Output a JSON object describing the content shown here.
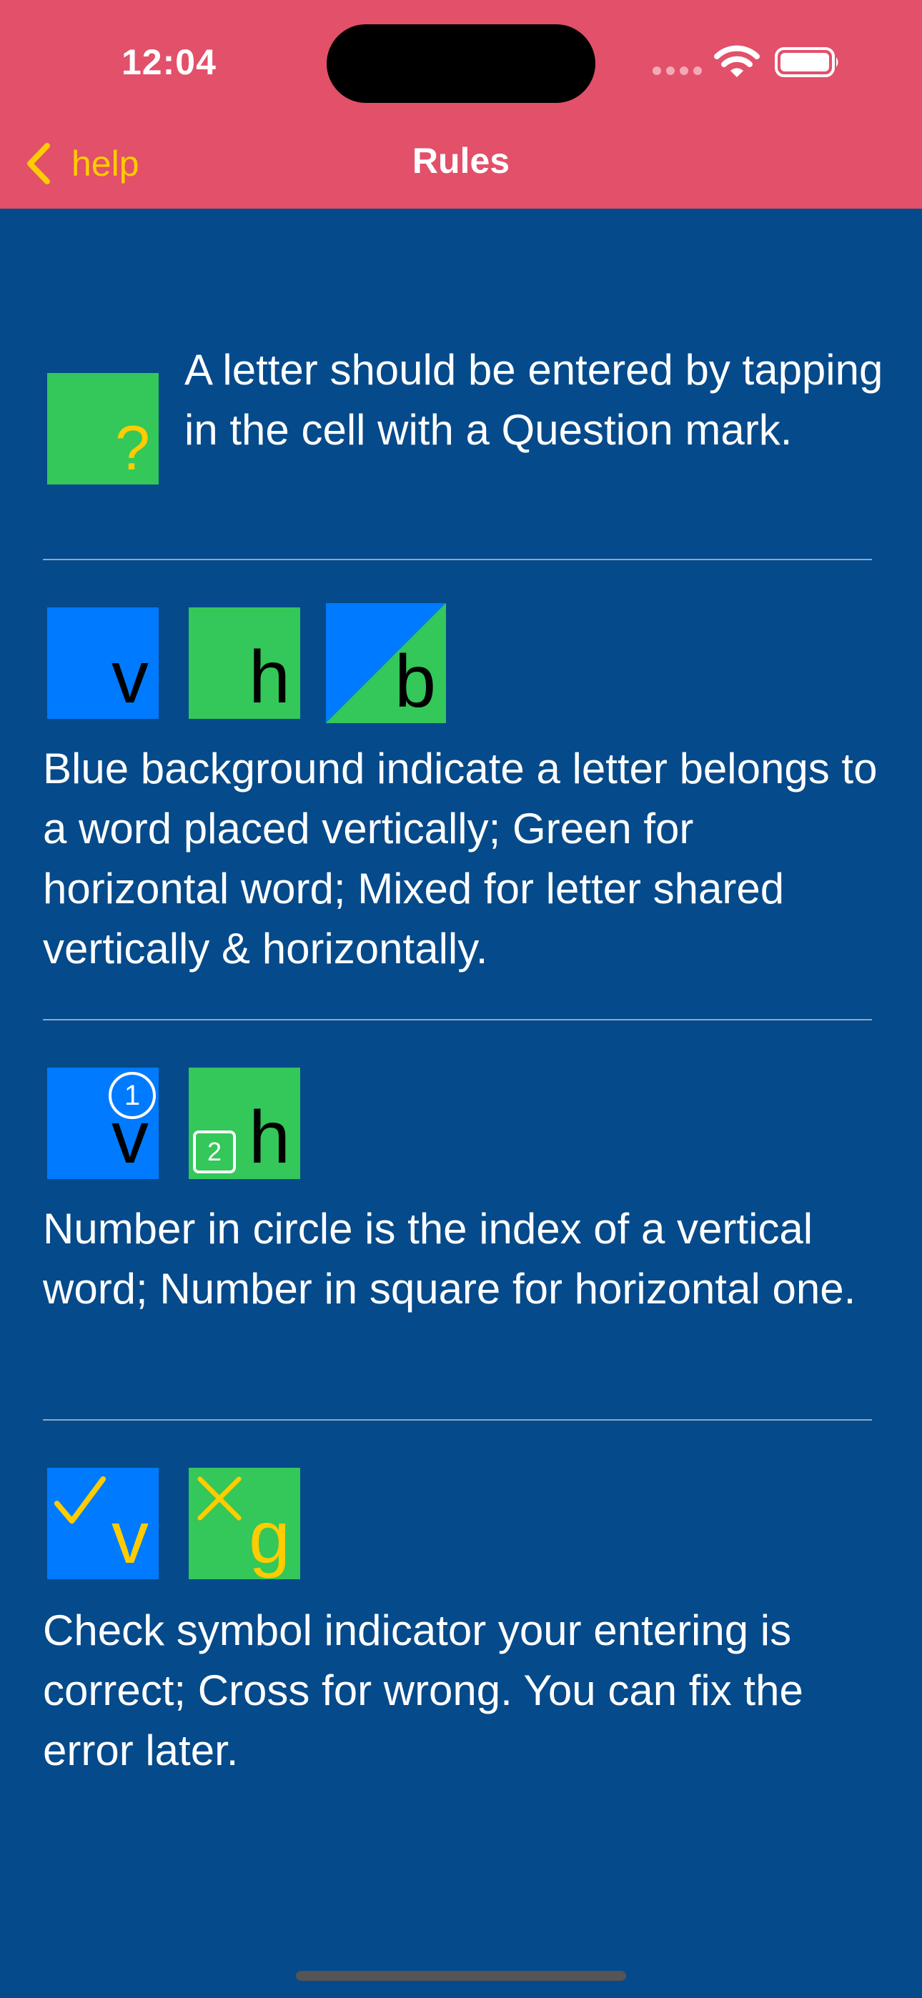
{
  "status_bar": {
    "time": "12:04",
    "icons": [
      "signal-dots-icon",
      "wifi-icon",
      "battery-icon"
    ]
  },
  "nav": {
    "back_label": "help",
    "title": "Rules"
  },
  "rules": [
    {
      "text": "A letter should be entered by tapping in the cell with a Question mark.",
      "cells": [
        {
          "color": "green",
          "symbol": "?"
        }
      ]
    },
    {
      "text": "Blue background indicate a letter belongs to a word placed vertically; Green for horizontal word; Mixed for letter shared  vertically & horizontally.",
      "cells": [
        {
          "color": "blue",
          "letter": "v"
        },
        {
          "color": "green",
          "letter": "h"
        },
        {
          "color": "mixed",
          "letter": "b"
        }
      ]
    },
    {
      "text": "Number in circle is the index of a vertical word; Number in square for horizontal one.",
      "cells": [
        {
          "color": "blue",
          "letter": "v",
          "circle_index": "1"
        },
        {
          "color": "green",
          "letter": "h",
          "square_index": "2"
        }
      ]
    },
    {
      "text": "Check symbol indicator your entering is correct; Cross for wrong. You can fix the error later.",
      "cells": [
        {
          "color": "blue",
          "letter": "v",
          "mark": "check-icon"
        },
        {
          "color": "green",
          "letter": "g",
          "mark": "cross-icon"
        }
      ]
    }
  ],
  "colors": {
    "header": "#E2506A",
    "background": "#054A8B",
    "blue_cell": "#007AFF",
    "green_cell": "#34C759",
    "accent_yellow": "#FFCC00"
  }
}
